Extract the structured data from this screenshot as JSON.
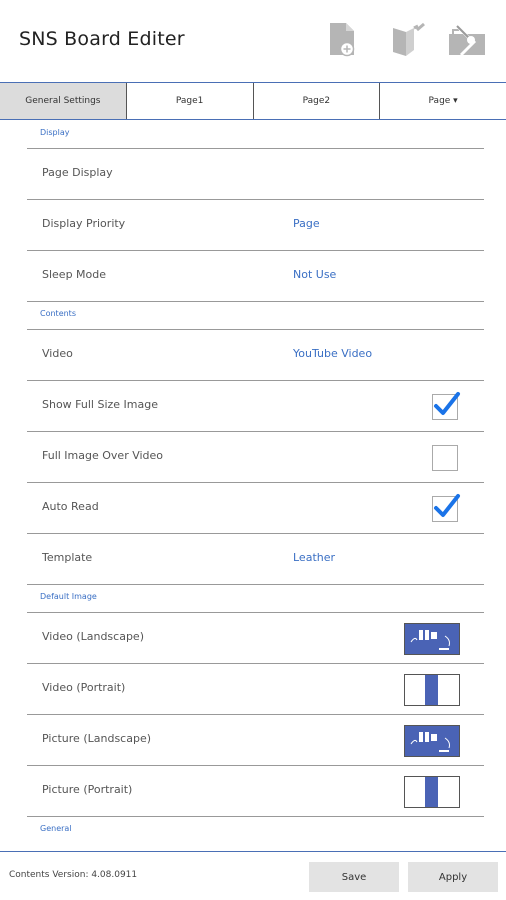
{
  "header": {
    "title": "SNS Board Editer",
    "icons": [
      "new-page-icon",
      "open-book-icon",
      "toolbox-icon"
    ]
  },
  "tabs": [
    {
      "label": "General Settings",
      "active": true
    },
    {
      "label": "Page1",
      "active": false
    },
    {
      "label": "Page2",
      "active": false
    },
    {
      "label": "Page ▾",
      "active": false
    }
  ],
  "sections": {
    "display": "Display",
    "contents": "Contents",
    "default_image": "Default Image",
    "general": "General"
  },
  "rows": {
    "page_display": {
      "label": "Page Display"
    },
    "display_priority": {
      "label": "Display Priority",
      "value": "Page"
    },
    "sleep_mode": {
      "label": "Sleep Mode",
      "value": "Not Use"
    },
    "video": {
      "label": "Video",
      "value": "YouTube Video"
    },
    "show_full_size": {
      "label": "Show Full Size Image",
      "checked": true
    },
    "full_image_over_video": {
      "label": "Full Image Over Video",
      "checked": false
    },
    "auto_read": {
      "label": "Auto Read",
      "checked": true
    },
    "template": {
      "label": "Template",
      "value": "Leather"
    },
    "video_landscape": {
      "label": "Video (Landscape)"
    },
    "video_portrait": {
      "label": "Video (Portrait)"
    },
    "picture_landscape": {
      "label": "Picture (Landscape)"
    },
    "picture_portrait": {
      "label": "Picture (Portrait)"
    }
  },
  "footer": {
    "version": "Contents Version: 4.08.0911",
    "save_label": "Save",
    "apply_label": "Apply"
  },
  "colors": {
    "accent": "#3a6fc4",
    "thumb": "#4a63b5",
    "icon_gray": "#b5b5b5"
  }
}
